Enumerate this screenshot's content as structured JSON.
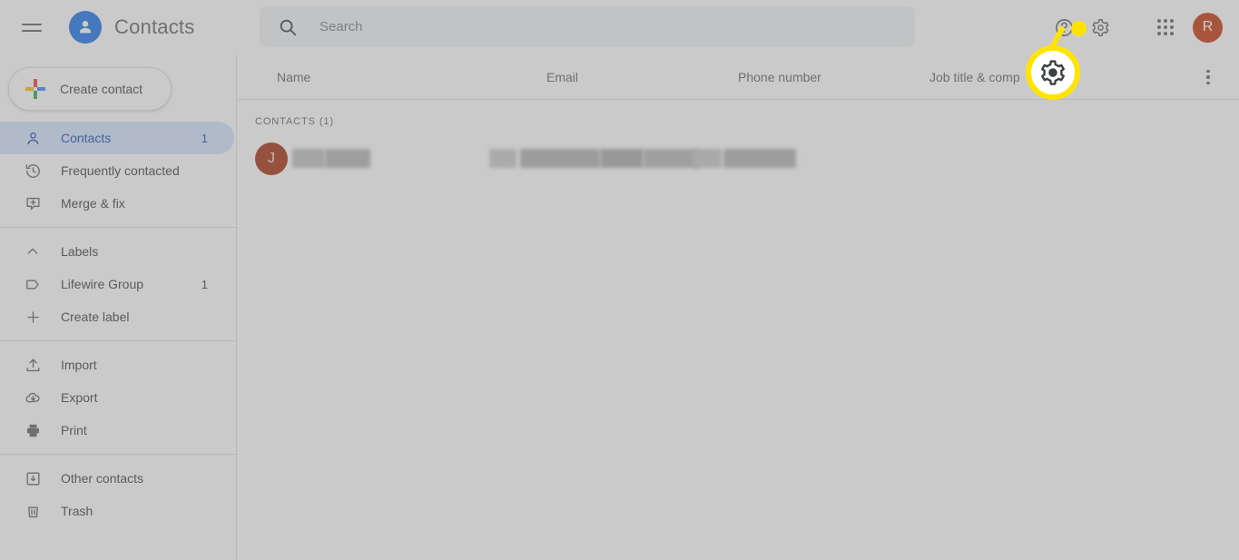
{
  "app": {
    "title": "Contacts",
    "logo_icon": "person-circle-icon",
    "menu_icon": "hamburger-menu-icon"
  },
  "search": {
    "placeholder": "Search",
    "value": "",
    "icon": "search-icon"
  },
  "topbar_actions": {
    "help_icon": "help-circle-icon",
    "settings_icon": "gear-icon",
    "apps_icon": "apps-grid-icon",
    "avatar_initial": "R",
    "avatar_color": "#c5360f"
  },
  "sidebar": {
    "create_button": {
      "label": "Create contact",
      "icon": "plus-icon"
    },
    "items": [
      {
        "label": "Contacts",
        "icon": "person-outline-icon",
        "count": "1",
        "active": true
      },
      {
        "label": "Frequently contacted",
        "icon": "history-icon",
        "count": "",
        "active": false
      },
      {
        "label": "Merge & fix",
        "icon": "merge-fix-icon",
        "count": "",
        "active": false
      }
    ],
    "labels_section": {
      "header": "Labels",
      "header_icon": "chevron-up-icon",
      "items": [
        {
          "label": "Lifewire Group",
          "icon": "label-tag-icon",
          "count": "1"
        },
        {
          "label": "Create label",
          "icon": "plus-thin-icon",
          "count": ""
        }
      ]
    },
    "tools": [
      {
        "label": "Import",
        "icon": "upload-icon"
      },
      {
        "label": "Export",
        "icon": "cloud-download-icon"
      },
      {
        "label": "Print",
        "icon": "printer-icon"
      }
    ],
    "footer_items": [
      {
        "label": "Other contacts",
        "icon": "other-contacts-icon"
      },
      {
        "label": "Trash",
        "icon": "trash-icon"
      }
    ]
  },
  "main": {
    "columns": [
      "Name",
      "Email",
      "Phone number",
      "Job title & comp"
    ],
    "more_options_icon": "more-vertical-icon",
    "section_label": "CONTACTS (1)",
    "rows": [
      {
        "avatar_initial": "J",
        "avatar_color": "#a6300f",
        "name": "",
        "email": "",
        "phone": "",
        "job": "",
        "redacted": true
      }
    ]
  },
  "annotation": {
    "type": "callout-highlight",
    "target_icon": "gear-icon",
    "highlight_color": "#ffe400"
  }
}
